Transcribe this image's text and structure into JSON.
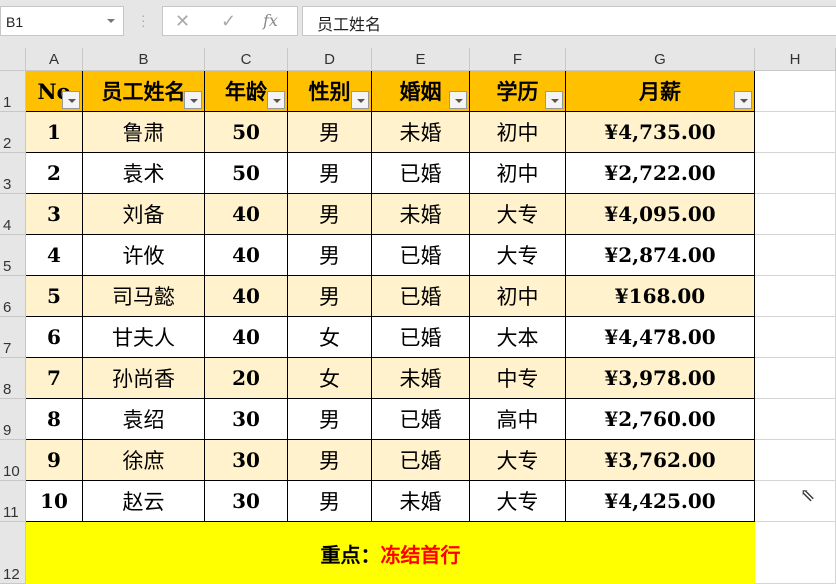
{
  "toolbar": {
    "name_box": "B1",
    "cancel_icon": "✕",
    "enter_icon": "✓",
    "fx_label": "fx",
    "formula": "员工姓名"
  },
  "columns": [
    "A",
    "B",
    "C",
    "D",
    "E",
    "F",
    "G",
    "H"
  ],
  "rows": [
    "1",
    "2",
    "3",
    "4",
    "5",
    "6",
    "7",
    "8",
    "9",
    "10",
    "11",
    "12"
  ],
  "headers": [
    "No",
    "员工姓名",
    "年龄",
    "性别",
    "婚姻",
    "学历",
    "月薪"
  ],
  "table": [
    [
      "1",
      "鲁肃",
      "50",
      "男",
      "未婚",
      "初中",
      "¥4,735.00"
    ],
    [
      "2",
      "袁术",
      "50",
      "男",
      "已婚",
      "初中",
      "¥2,722.00"
    ],
    [
      "3",
      "刘备",
      "40",
      "男",
      "未婚",
      "大专",
      "¥4,095.00"
    ],
    [
      "4",
      "许攸",
      "40",
      "男",
      "已婚",
      "大专",
      "¥2,874.00"
    ],
    [
      "5",
      "司马懿",
      "40",
      "男",
      "已婚",
      "初中",
      "¥168.00"
    ],
    [
      "6",
      "甘夫人",
      "40",
      "女",
      "已婚",
      "大本",
      "¥4,478.00"
    ],
    [
      "7",
      "孙尚香",
      "20",
      "女",
      "未婚",
      "中专",
      "¥3,978.00"
    ],
    [
      "8",
      "袁绍",
      "30",
      "男",
      "已婚",
      "高中",
      "¥2,760.00"
    ],
    [
      "9",
      "徐庶",
      "30",
      "男",
      "已婚",
      "大专",
      "¥3,762.00"
    ],
    [
      "10",
      "赵云",
      "30",
      "男",
      "未婚",
      "大专",
      "¥4,425.00"
    ]
  ],
  "note": {
    "prefix": "重点：",
    "text": "冻结首行"
  },
  "colors": {
    "header": "#FFC000",
    "band": "#FFF2CC",
    "note_bg": "#FFFF00",
    "note_text": "#FF0000"
  }
}
